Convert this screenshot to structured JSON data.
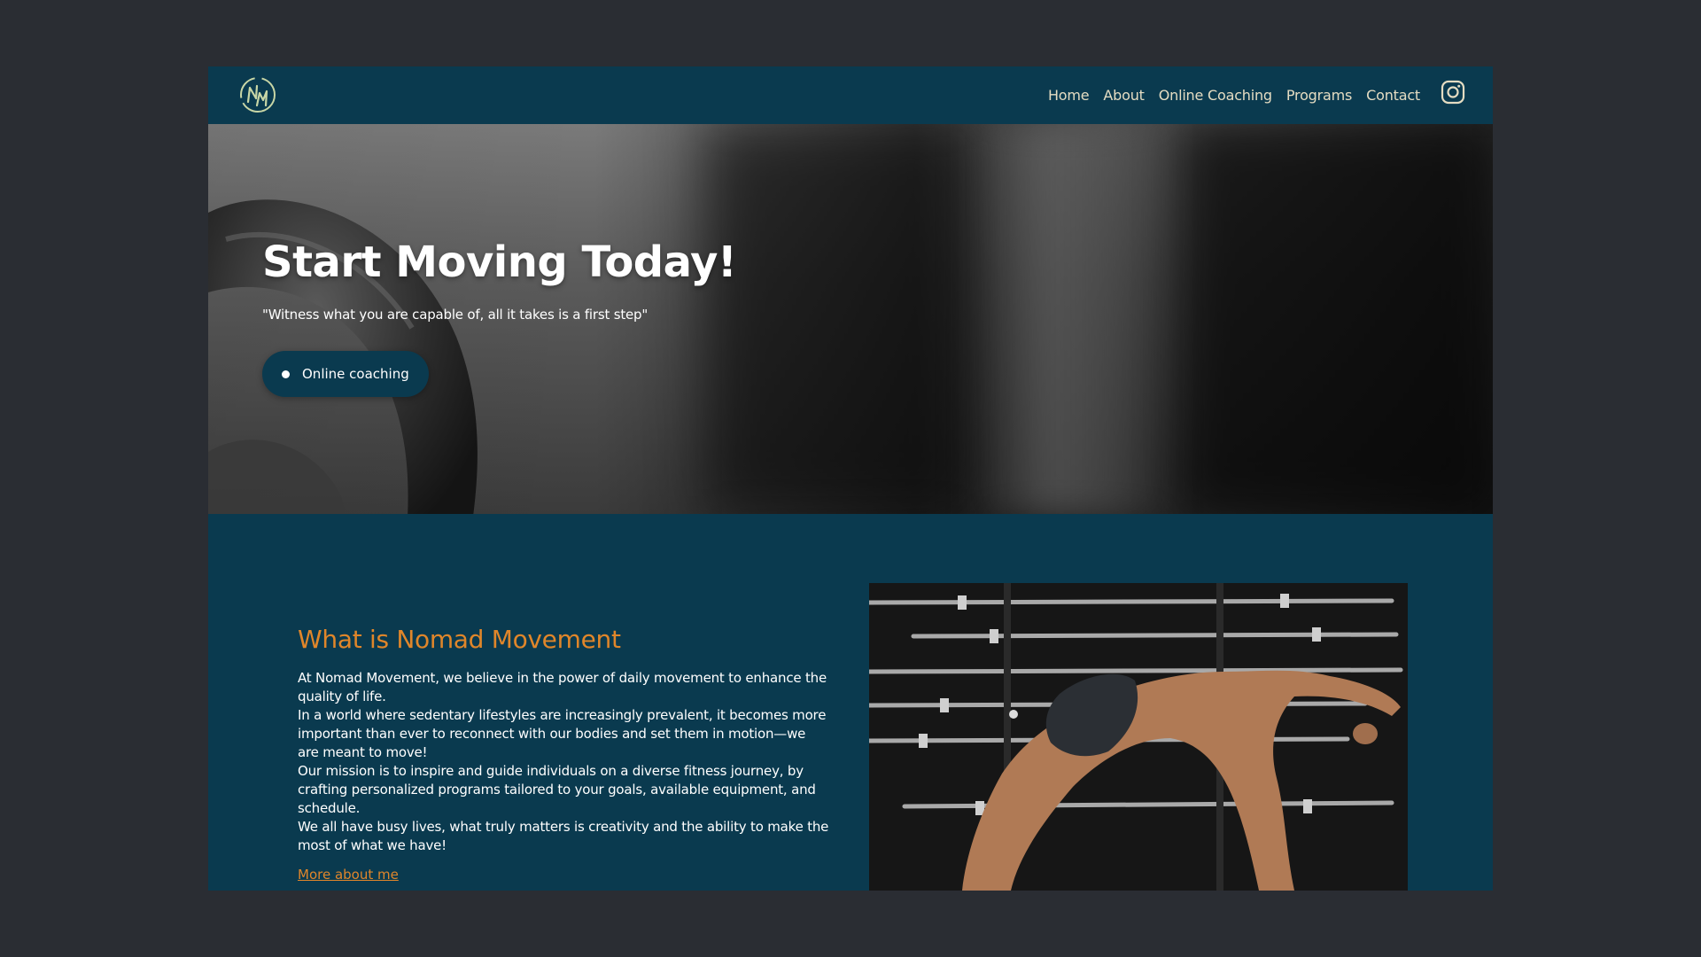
{
  "brand": {
    "logo_text": "NM",
    "accent_color": "#e0862a",
    "primary_color": "#0a3a4f"
  },
  "nav": {
    "items": [
      {
        "label": "Home"
      },
      {
        "label": "About"
      },
      {
        "label": "Online Coaching"
      },
      {
        "label": "Programs"
      },
      {
        "label": "Contact"
      }
    ],
    "social_icon": "instagram-icon"
  },
  "hero": {
    "title": "Start Moving Today!",
    "subtitle": "\"Witness what you are capable of, all it takes is a first step\"",
    "button_label": "Online coaching"
  },
  "about": {
    "heading": "What is Nomad Movement",
    "paragraphs": [
      "At Nomad Movement, we believe in the power of daily movement to enhance the quality of life.",
      "In a world where sedentary lifestyles are increasingly prevalent, it becomes more important than ever to reconnect with our bodies and set them in motion—we are meant to move!",
      "Our mission is to inspire and guide individuals on a diverse fitness journey, by crafting personalized programs tailored to your goals, available equipment, and schedule.",
      "We all have busy lives, what truly matters is creativity and the ability to make the most of what we have!"
    ],
    "link_label": "More about me"
  }
}
